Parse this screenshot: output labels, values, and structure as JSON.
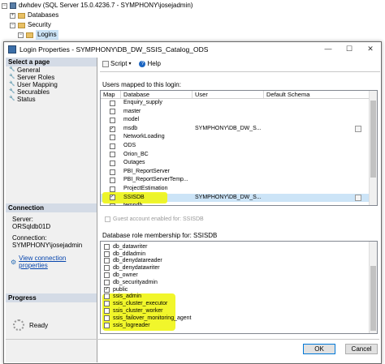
{
  "explorer": {
    "server": "dwhdev (SQL Server 15.0.4236.7 - SYMPHONY\\josejadmin)",
    "databases": "Databases",
    "security": "Security",
    "logins": "Logins"
  },
  "dialog": {
    "title": "Login Properties - SYMPHONY\\DB_DW_SSIS_Catalog_ODS",
    "minimize": "—",
    "maximize": "☐",
    "close": "✕"
  },
  "left_pane": {
    "select_page_header": "Select a page",
    "pages": [
      "General",
      "Server Roles",
      "User Mapping",
      "Securables",
      "Status"
    ],
    "connection_header": "Connection",
    "server_label": "Server:",
    "server_value": "ORSqldb01D",
    "connection_label": "Connection:",
    "connection_value": "SYMPHONY\\josejadmin",
    "view_connection_link": "View connection properties",
    "progress_header": "Progress",
    "progress_status": "Ready"
  },
  "toolbar": {
    "script_label": "Script",
    "help_label": "Help"
  },
  "users_mapped": {
    "label": "Users mapped to this login:",
    "columns": [
      "Map",
      "Database",
      "User",
      "Default Schema"
    ],
    "rows": [
      {
        "checked": false,
        "database": "Enquiry_supply",
        "user": "",
        "has_schema_btn": false
      },
      {
        "checked": false,
        "database": "master",
        "user": "",
        "has_schema_btn": false
      },
      {
        "checked": false,
        "database": "model",
        "user": "",
        "has_schema_btn": false
      },
      {
        "checked": true,
        "database": "msdb",
        "user": "SYMPHONY\\DB_DW_S...",
        "has_schema_btn": true
      },
      {
        "checked": false,
        "database": "NetworkLoading",
        "user": "",
        "has_schema_btn": false
      },
      {
        "checked": false,
        "database": "ODS",
        "user": "",
        "has_schema_btn": false
      },
      {
        "checked": false,
        "database": "Orion_BC",
        "user": "",
        "has_schema_btn": false
      },
      {
        "checked": false,
        "database": "Outages",
        "user": "",
        "has_schema_btn": false
      },
      {
        "checked": false,
        "database": "PBI_ReportServer",
        "user": "",
        "has_schema_btn": false
      },
      {
        "checked": false,
        "database": "PBI_ReportServerTemp...",
        "user": "",
        "has_schema_btn": false
      },
      {
        "checked": false,
        "database": "ProjectEstimation",
        "user": "",
        "has_schema_btn": false
      },
      {
        "checked": true,
        "database": "SSISDB",
        "user": "SYMPHONY\\DB_DW_S...",
        "has_schema_btn": true,
        "selected": true
      },
      {
        "checked": false,
        "database": "tempdb",
        "user": "",
        "has_schema_btn": false
      }
    ]
  },
  "guest_label": "Guest account enabled for: SSISDB",
  "roles": {
    "label": "Database role membership for: SSISDB",
    "items": [
      {
        "name": "db_datawriter",
        "checked": false
      },
      {
        "name": "db_ddladmin",
        "checked": false
      },
      {
        "name": "db_denydatareader",
        "checked": false
      },
      {
        "name": "db_denydatawriter",
        "checked": false
      },
      {
        "name": "db_owner",
        "checked": false
      },
      {
        "name": "db_securityadmin",
        "checked": false
      },
      {
        "name": "public",
        "checked": true
      },
      {
        "name": "ssis_admin",
        "checked": false
      },
      {
        "name": "ssis_cluster_executor",
        "checked": false
      },
      {
        "name": "ssis_cluster_worker",
        "checked": false
      },
      {
        "name": "ssis_failover_monitoring_agent",
        "checked": false
      },
      {
        "name": "ssis_logreader",
        "checked": false
      }
    ]
  },
  "buttons": {
    "ok": "OK",
    "cancel": "Cancel"
  },
  "colors": {
    "highlight": "#f0f514",
    "selection": "#cce4f7",
    "link": "#0645ad"
  }
}
